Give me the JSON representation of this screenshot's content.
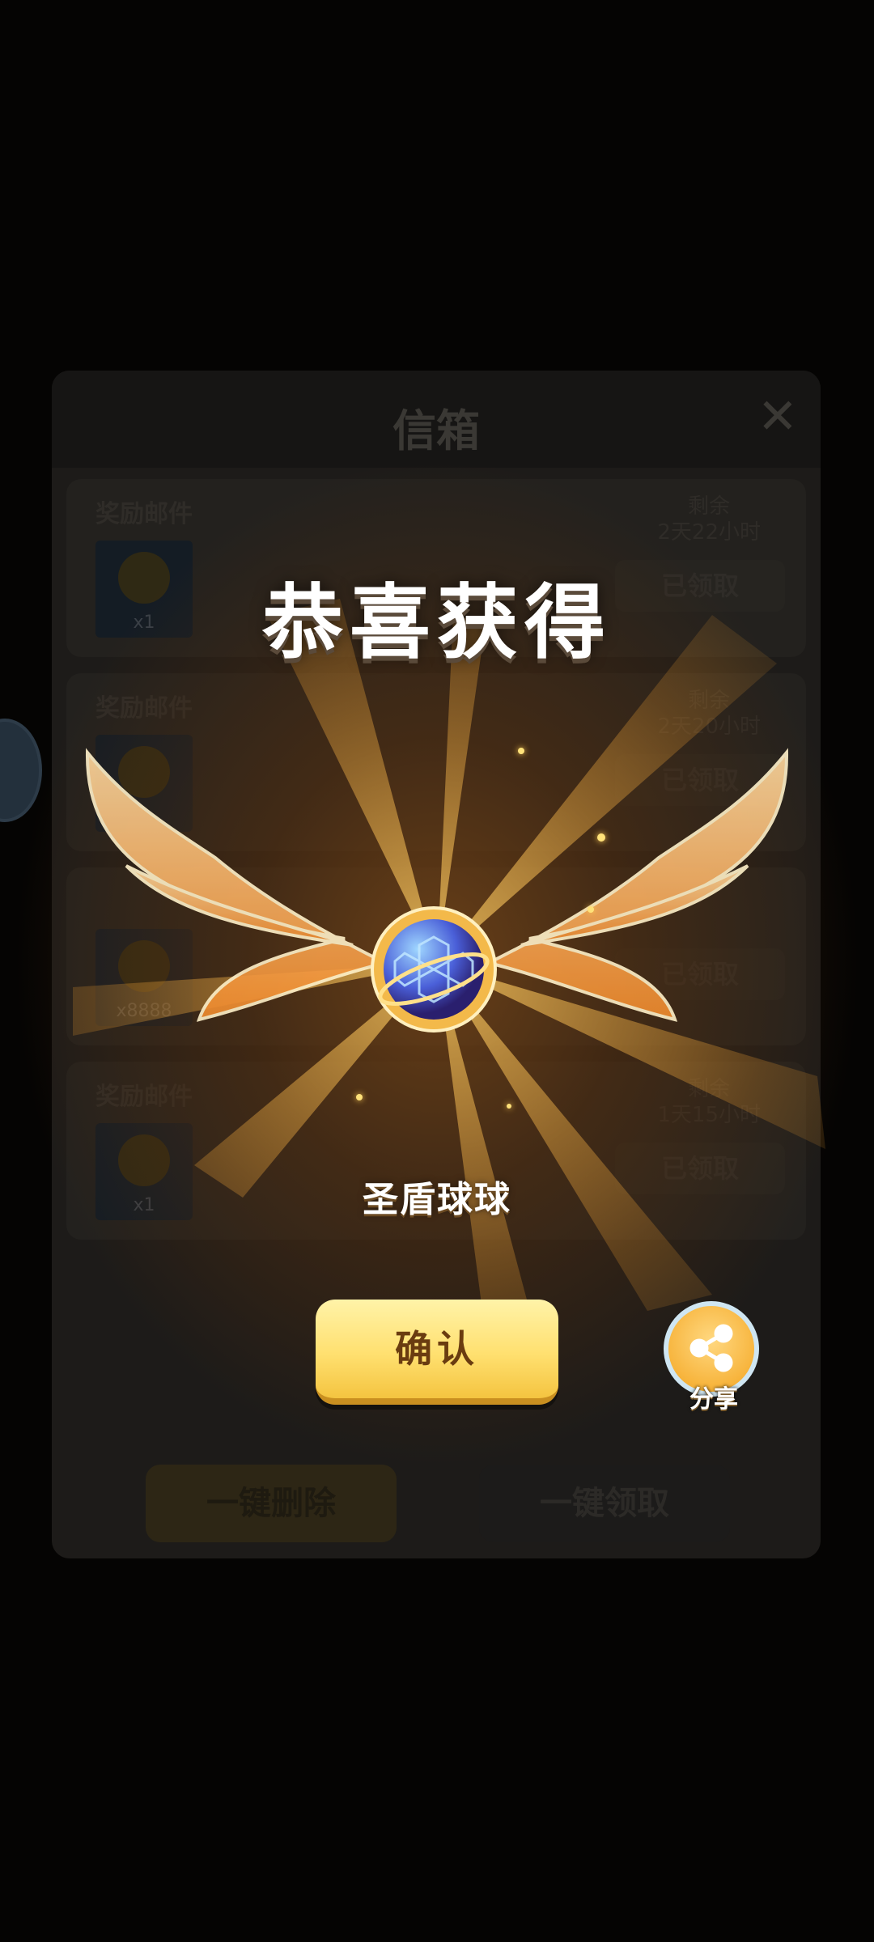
{
  "mailbox": {
    "title": "信箱",
    "close_icon": "close-icon",
    "mails": [
      {
        "title": "奖励邮件",
        "count": "x1",
        "remain_label": "剩余",
        "remain_time": "2天22小时",
        "status": "已领取"
      },
      {
        "title": "奖励邮件",
        "count": "",
        "remain_label": "剩余",
        "remain_time": "2天20小时",
        "status": "已领取"
      },
      {
        "title": "",
        "count": "x8888",
        "remain_label": "",
        "remain_time": "",
        "status": "已领取"
      },
      {
        "title": "奖励邮件",
        "count": "x1",
        "remain_label": "剩余",
        "remain_time": "1天15小时",
        "status": "已领取"
      }
    ],
    "delete_all_label": "一键删除",
    "claim_all_label": "一键领取"
  },
  "popup": {
    "headline": "恭喜获得",
    "item_name": "圣盾球球",
    "item_icon": "holy-shield-orb-icon",
    "confirm_label": "确认",
    "share_label": "分享"
  },
  "colors": {
    "accent_gold": "#ffe070",
    "glow": "#7d4816",
    "wing": "#f5a24a"
  }
}
